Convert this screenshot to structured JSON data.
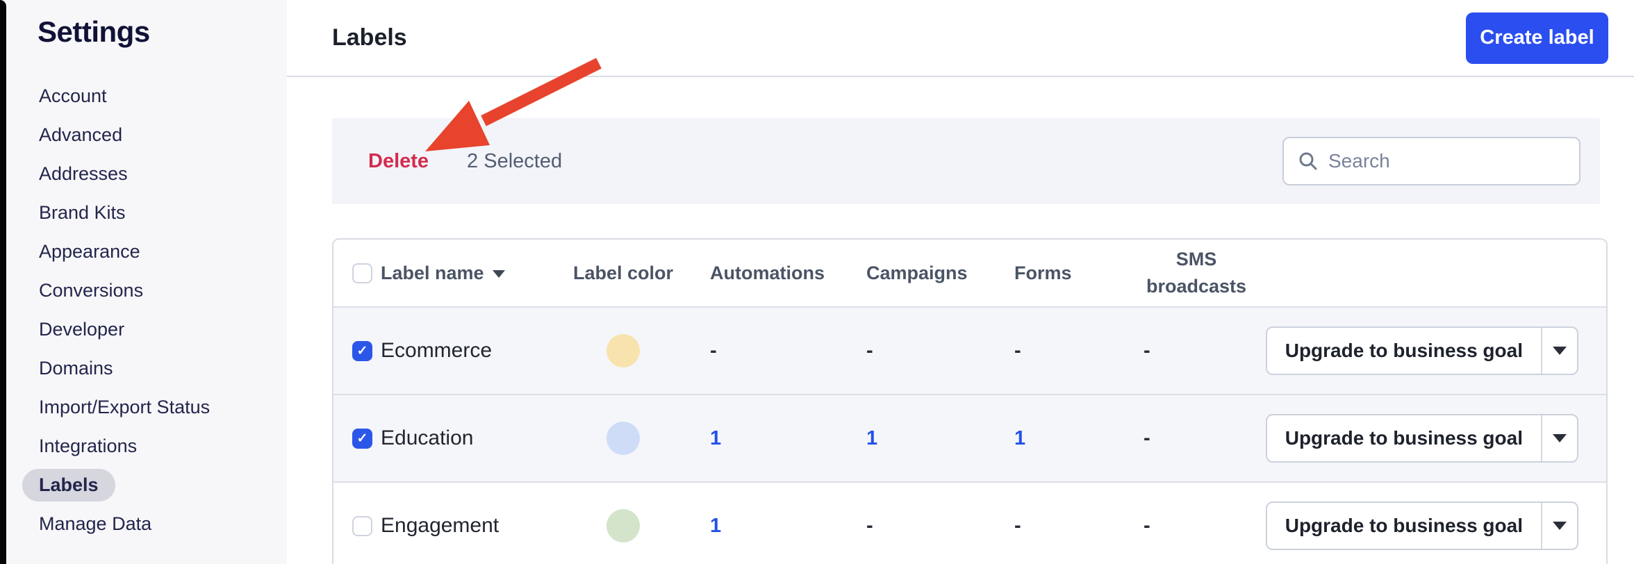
{
  "sidebar": {
    "title": "Settings",
    "items": [
      {
        "label": "Account",
        "active": false
      },
      {
        "label": "Advanced",
        "active": false
      },
      {
        "label": "Addresses",
        "active": false
      },
      {
        "label": "Brand Kits",
        "active": false
      },
      {
        "label": "Appearance",
        "active": false
      },
      {
        "label": "Conversions",
        "active": false
      },
      {
        "label": "Developer",
        "active": false
      },
      {
        "label": "Domains",
        "active": false
      },
      {
        "label": "Import/Export Status",
        "active": false
      },
      {
        "label": "Integrations",
        "active": false
      },
      {
        "label": "Labels",
        "active": true
      },
      {
        "label": "Manage Data",
        "active": false
      }
    ]
  },
  "header": {
    "title": "Labels",
    "create_button_label": "Create label"
  },
  "toolbar": {
    "delete_label": "Delete",
    "selection_text": "2 Selected",
    "search_placeholder": "Search",
    "search_icon": "magnifier"
  },
  "table": {
    "columns": {
      "label_name": "Label name",
      "label_color": "Label color",
      "automations": "Automations",
      "campaigns": "Campaigns",
      "forms": "Forms",
      "sms_broadcasts": "SMS broadcasts"
    },
    "sort": {
      "column": "Label name",
      "direction": "descending"
    },
    "rows": [
      {
        "name": "Ecommerce",
        "checked": true,
        "color": "#f8e3ae",
        "automations": "-",
        "campaigns": "-",
        "forms": "-",
        "sms_broadcasts": "-",
        "action_label": "Upgrade to business goal"
      },
      {
        "name": "Education",
        "checked": true,
        "color": "#cfdcf7",
        "automations": "1",
        "campaigns": "1",
        "forms": "1",
        "sms_broadcasts": "-",
        "action_label": "Upgrade to business goal"
      },
      {
        "name": "Engagement",
        "checked": false,
        "color": "#d3e4cb",
        "automations": "1",
        "campaigns": "-",
        "forms": "-",
        "sms_broadcasts": "-",
        "action_label": "Upgrade to business goal"
      }
    ]
  },
  "annotation_arrow": {
    "color": "#e8432c",
    "points_at": "Delete"
  },
  "colors": {
    "accent_blue": "#2b4ef0",
    "link_blue": "#2351e8",
    "checkbox_blue": "#2b57e8",
    "delete_red": "#d22c4d",
    "selected_row_bg": "#f5f6fa",
    "toolbar_bg": "#f3f4f9",
    "sidebar_bg": "#f7f7f9"
  }
}
